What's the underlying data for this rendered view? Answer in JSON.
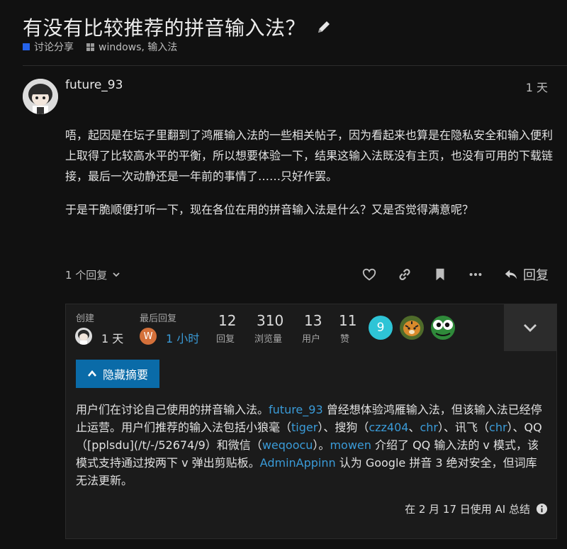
{
  "topic": {
    "title": "有没有比较推荐的拼音输入法？",
    "category": "讨论分享",
    "tags": "windows, 输入法",
    "category_color": "#2563eb"
  },
  "post": {
    "username": "future_93",
    "date": "1 天",
    "paragraphs": [
      "唔，起因是在坛子里翻到了鸿雁输入法的一些相关帖子，因为看起来也算是在隐私安全和输入便利上取得了比较高水平的平衡，所以想要体验一下，结果这输入法既没有主页，也没有可用的下载链接，最后一次动静还是一年前的事情了……只好作罢。",
      "于是干脆顺便打听一下，现在各位在用的拼音输入法是什么？又是否觉得满意呢？"
    ],
    "replies_toggle": "1 个回复",
    "reply_label": "回复"
  },
  "summary": {
    "created_label": "创建",
    "created_value": "1 天",
    "last_reply_label": "最后回复",
    "last_reply_value": "1 小时",
    "last_reply_avatar_letter": "W",
    "stats": [
      {
        "num": "12",
        "label": "回复"
      },
      {
        "num": "310",
        "label": "浏览量"
      },
      {
        "num": "13",
        "label": "用户"
      },
      {
        "num": "11",
        "label": "赞"
      }
    ],
    "participant_badge": "9",
    "hide_button": "隐藏摘要",
    "text_parts": [
      {
        "t": "用户们在讨论自己使用的拼音输入法。",
        "link": false
      },
      {
        "t": "future_93",
        "link": true
      },
      {
        "t": " 曾经想体验鸿雁输入法，但该输入法已经停止运营。用户们推荐的输入法包括小狼毫（",
        "link": false
      },
      {
        "t": "tiger",
        "link": true
      },
      {
        "t": "）、搜狗（",
        "link": false
      },
      {
        "t": "czz404",
        "link": true
      },
      {
        "t": "、",
        "link": false
      },
      {
        "t": "chr",
        "link": true
      },
      {
        "t": "）、讯飞（",
        "link": false
      },
      {
        "t": "chr",
        "link": true
      },
      {
        "t": "）、QQ（[pplsdu](/t/-/52674/9）和微信（",
        "link": false
      },
      {
        "t": "weqoocu",
        "link": true
      },
      {
        "t": "）。",
        "link": false
      },
      {
        "t": "mowen",
        "link": true
      },
      {
        "t": " 介绍了 QQ 输入法的 v 模式，该模式支持通过按两下 v 弹出剪贴板。",
        "link": false
      },
      {
        "t": "AdminAppinn",
        "link": true
      },
      {
        "t": " 认为 Google 拼音 3 绝对安全，但词库无法更新。",
        "link": false
      }
    ],
    "footer": "在 2 月 17 日使用 AI 总结"
  }
}
